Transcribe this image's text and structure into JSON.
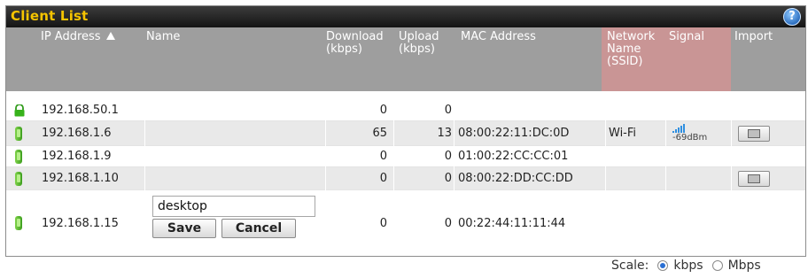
{
  "panel": {
    "title": "Client List",
    "help_label": "?"
  },
  "columns": {
    "ip": "IP Address",
    "name": "Name",
    "download": "Download (kbps)",
    "upload": "Upload (kbps)",
    "mac": "MAC Address",
    "ssid": "Network Name (SSID)",
    "signal": "Signal",
    "import": "Import"
  },
  "colors": {
    "title": "#f5c400",
    "header_bg": "#9e9e9e",
    "ssid_header_bg": "#c99595",
    "alt_row": "#e9e9e9",
    "device_green": "#5cbf2a",
    "signal_blue": "#2f8fe0"
  },
  "rows": [
    {
      "icon": "lock-icon",
      "ip": "192.168.50.1",
      "name": "",
      "download": "0",
      "upload": "0",
      "mac": "",
      "ssid": "",
      "signal": "",
      "import": false
    },
    {
      "icon": "device-icon",
      "ip": "192.168.1.6",
      "name": "",
      "download": "65",
      "upload": "13",
      "mac": "08:00:22:11:DC:0D",
      "ssid": "Wi-Fi",
      "signal": "-69dBm",
      "import": true
    },
    {
      "icon": "device-icon",
      "ip": "192.168.1.9",
      "name": "",
      "download": "0",
      "upload": "0",
      "mac": "01:00:22:CC:CC:01",
      "ssid": "",
      "signal": "",
      "import": false
    },
    {
      "icon": "device-icon",
      "ip": "192.168.1.10",
      "name": "",
      "download": "0",
      "upload": "0",
      "mac": "08:00:22:DD:CC:DD",
      "ssid": "",
      "signal": "",
      "import": true
    },
    {
      "icon": "device-icon",
      "ip": "192.168.1.15",
      "name": "desktop",
      "download": "0",
      "upload": "0",
      "mac": "00:22:44:11:11:44",
      "ssid": "",
      "signal": "",
      "import": false
    }
  ],
  "edit": {
    "value": "desktop",
    "save_label": "Save",
    "cancel_label": "Cancel"
  },
  "scale": {
    "label": "Scale:",
    "options": [
      "kbps",
      "Mbps"
    ],
    "selected": "kbps"
  }
}
